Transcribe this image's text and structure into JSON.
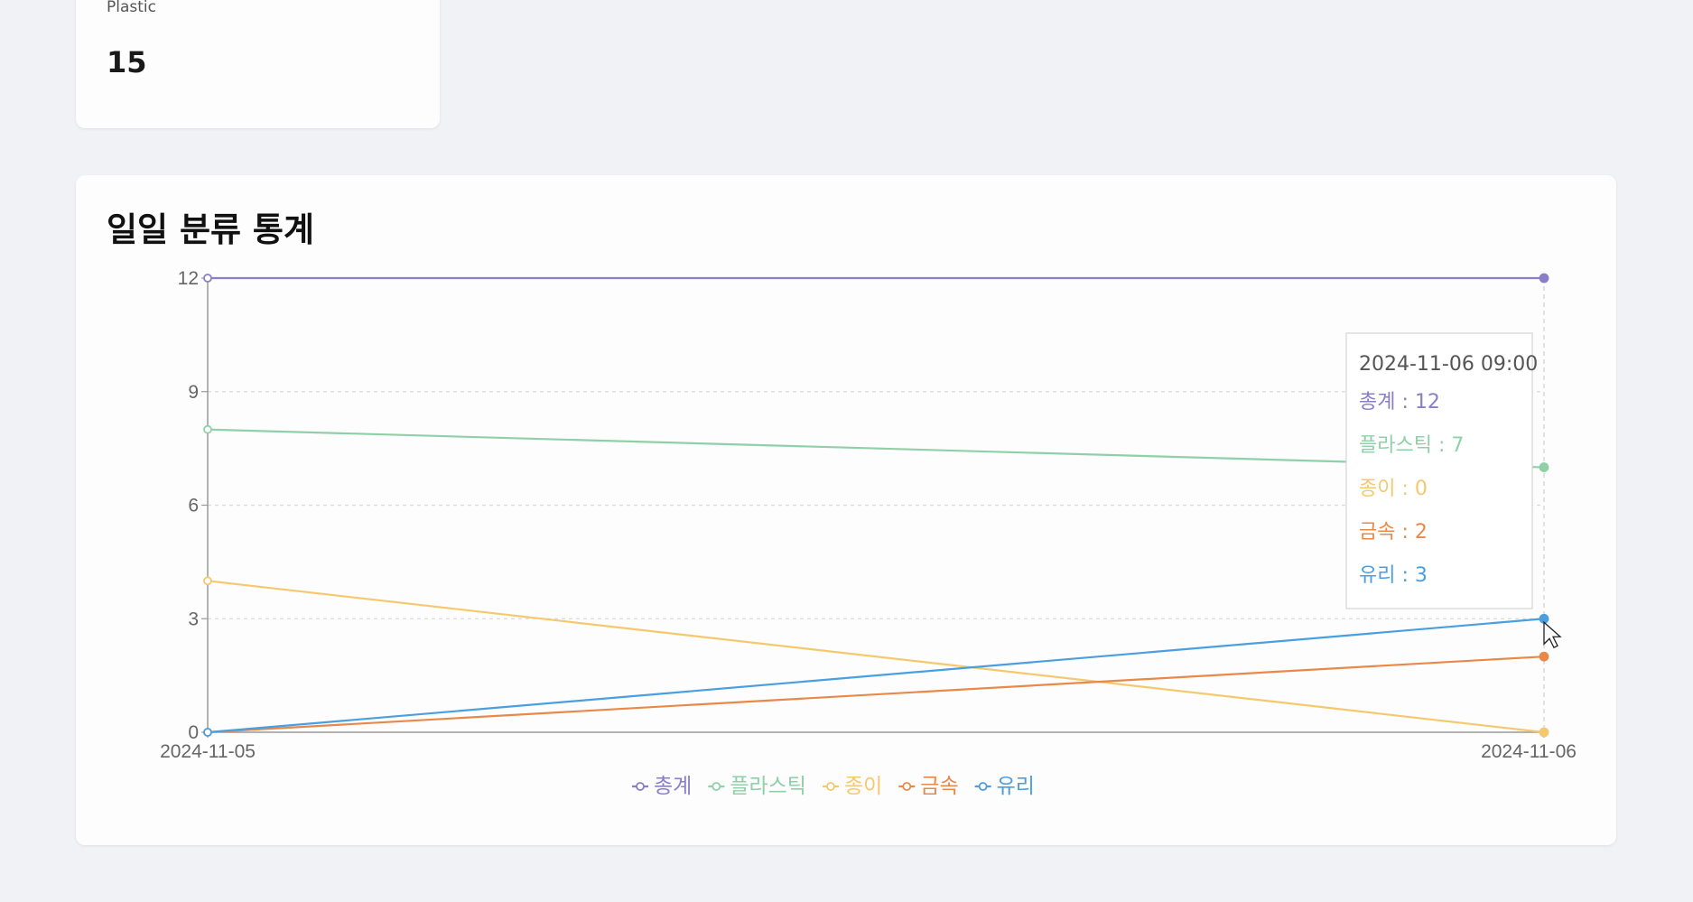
{
  "stat_card": {
    "label": "Plastic",
    "value": "15"
  },
  "chart_section": {
    "title": "일일 분류 통계"
  },
  "chart_data": {
    "type": "line",
    "x": [
      "2024-11-05",
      "2024-11-06"
    ],
    "ylim": [
      0,
      12
    ],
    "yticks": [
      0,
      3,
      6,
      9,
      12
    ],
    "grid": true,
    "legend_position": "bottom-center",
    "series": [
      {
        "name": "총계",
        "values": [
          12,
          12
        ],
        "color": "#8b7ec8"
      },
      {
        "name": "플라스틱",
        "values": [
          8,
          7
        ],
        "color": "#8fd0a8"
      },
      {
        "name": "종이",
        "values": [
          4,
          0
        ],
        "color": "#f6c86e"
      },
      {
        "name": "금속",
        "values": [
          0,
          2
        ],
        "color": "#e8894a"
      },
      {
        "name": "유리",
        "values": [
          0,
          3
        ],
        "color": "#4a9fe0"
      }
    ],
    "tooltip": {
      "title": "2024-11-06 09:00",
      "items": [
        "총계 : 12",
        "플라스틱 : 7",
        "종이 : 0",
        "금속 : 2",
        "유리 : 3"
      ]
    }
  }
}
